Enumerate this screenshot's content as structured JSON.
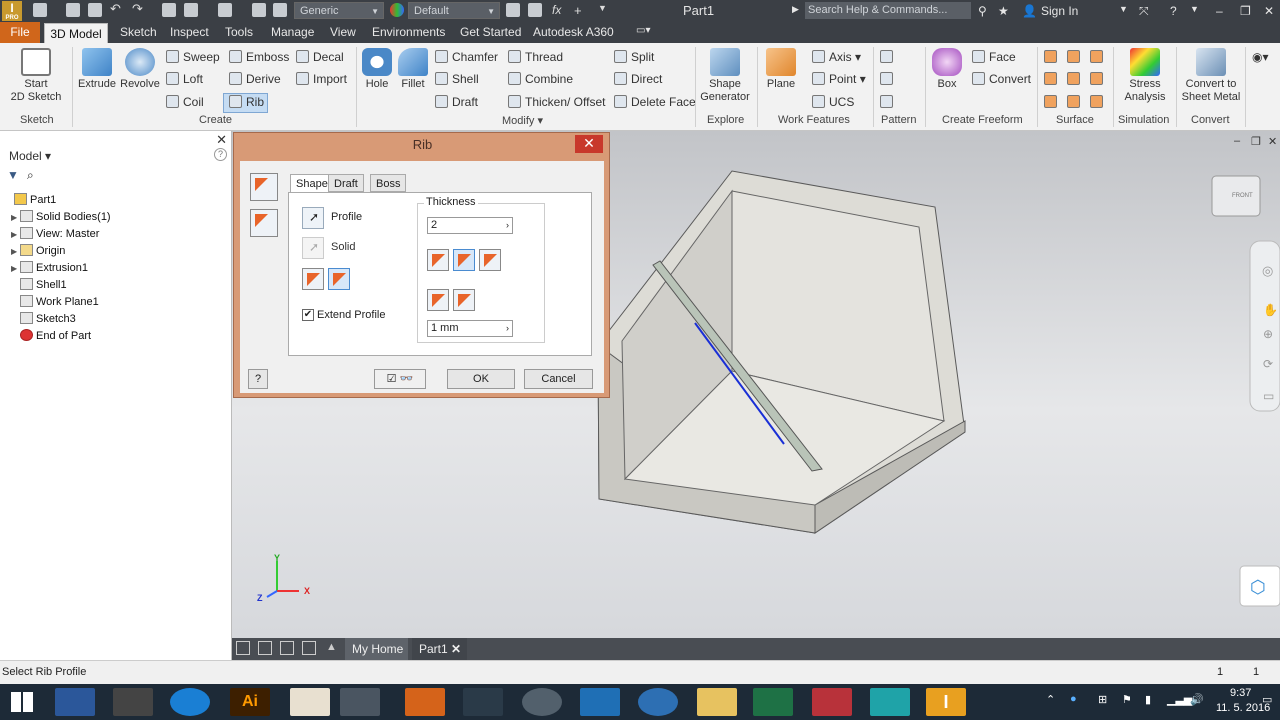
{
  "titlebar": {
    "material_combo": "Generic",
    "appearance_combo": "Default",
    "document_title": "Part1",
    "search_placeholder": "Search Help & Commands...",
    "sign_in": "Sign In"
  },
  "menu": {
    "file": "File",
    "tabs": [
      "3D Model",
      "Sketch",
      "Inspect",
      "Tools",
      "Manage",
      "View",
      "Environments",
      "Get Started",
      "Autodesk A360"
    ]
  },
  "ribbon": {
    "sketch": {
      "start_sketch": "Start\n2D Sketch",
      "group": "Sketch"
    },
    "create": {
      "extrude": "Extrude",
      "revolve": "Revolve",
      "sweep": "Sweep",
      "loft": "Loft",
      "coil": "Coil",
      "emboss": "Emboss",
      "derive": "Derive",
      "rib": "Rib",
      "decal": "Decal",
      "import": "Import",
      "group": "Create"
    },
    "modify": {
      "hole": "Hole",
      "fillet": "Fillet",
      "chamfer": "Chamfer",
      "shell": "Shell",
      "draft": "Draft",
      "thread": "Thread",
      "combine": "Combine",
      "thicken": "Thicken/ Offset",
      "split": "Split",
      "direct": "Direct",
      "delete_face": "Delete Face",
      "group": "Modify ▾"
    },
    "explore": {
      "shape_generator": "Shape\nGenerator",
      "group": "Explore"
    },
    "work_features": {
      "plane": "Plane",
      "axis": "Axis",
      "point": "Point",
      "ucs": "UCS",
      "group": "Work Features"
    },
    "pattern": {
      "group": "Pattern"
    },
    "freeform": {
      "box": "Box",
      "face": "Face",
      "convert": "Convert",
      "group": "Create Freeform"
    },
    "surface": {
      "group": "Surface"
    },
    "simulation": {
      "stress": "Stress\nAnalysis",
      "group": "Simulation"
    },
    "convert": {
      "sheet_metal": "Convert to\nSheet Metal",
      "group": "Convert"
    }
  },
  "browser": {
    "title": "Model",
    "items": [
      "Part1",
      "Solid Bodies(1)",
      "View: Master",
      "Origin",
      "Extrusion1",
      "Shell1",
      "Work Plane1",
      "Sketch3",
      "End of Part"
    ]
  },
  "dialog": {
    "title": "Rib",
    "tabs": [
      "Shape",
      "Draft",
      "Boss"
    ],
    "profile": "Profile",
    "solid": "Solid",
    "extend_profile": "Extend Profile",
    "extend_profile_checked": true,
    "thickness_label": "Thickness",
    "thickness_value": "2",
    "extent_value": "1 mm",
    "ok": "OK",
    "cancel": "Cancel"
  },
  "viewport": {
    "viewcube_label": "FRONT",
    "axis_x": "X",
    "axis_y": "Y",
    "axis_z": "Z"
  },
  "bottom_tabs": {
    "home": "My Home",
    "part": "Part1"
  },
  "status": {
    "prompt": "Select Rib Profile",
    "count1": "1",
    "count2": "1"
  },
  "taskbar": {
    "time": "9:37",
    "date": "11. 5. 2016"
  }
}
